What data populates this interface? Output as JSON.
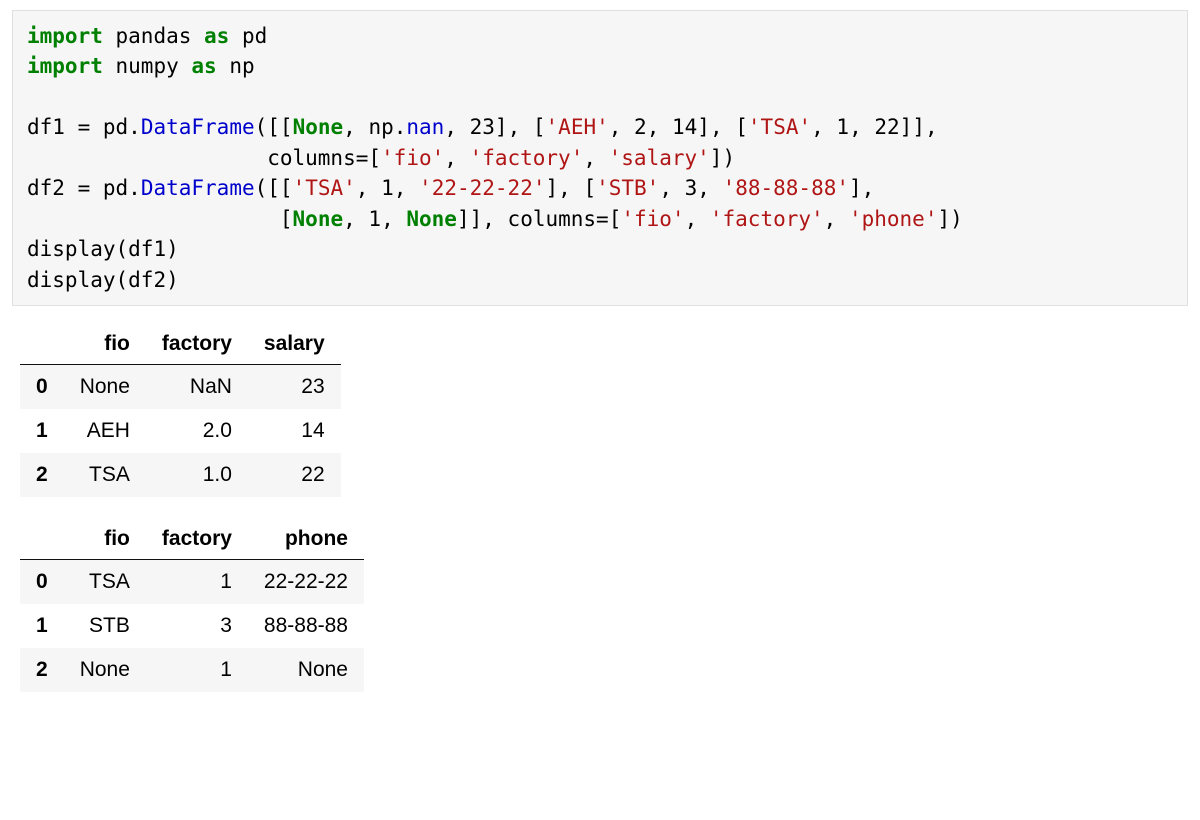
{
  "code": {
    "import_kw": "import",
    "as_kw": "as",
    "pandas": "pandas",
    "pd": "pd",
    "numpy": "numpy",
    "np": "np",
    "df1": "df1",
    "df2": "df2",
    "eq": " = ",
    "pd_pref": "pd.",
    "dataframe": "DataFrame",
    "np_pref": "np.",
    "nan": "nan",
    "none": "None",
    "n23": "23",
    "n2": "2",
    "n14": "14",
    "n1": "1",
    "n22": "22",
    "n3": "3",
    "s_AEH": "'AEH'",
    "s_TSA": "'TSA'",
    "s_STB": "'STB'",
    "s_222222": "'22-22-22'",
    "s_888888": "'88-88-88'",
    "s_fio": "'fio'",
    "s_factory": "'factory'",
    "s_salary": "'salary'",
    "s_phone": "'phone'",
    "columns_kw": "columns=",
    "lp": "(",
    "rp": ")",
    "lb": "[",
    "rb": "]",
    "c": ", ",
    "c2": ",",
    "indent1": "                   ",
    "indent2": "                    ",
    "display": "display",
    "disp1_arg": "(df1)",
    "disp2_arg": "(df2)"
  },
  "tables": {
    "t1": {
      "headers": [
        "",
        "fio",
        "factory",
        "salary"
      ],
      "rows": [
        [
          "0",
          "None",
          "NaN",
          "23"
        ],
        [
          "1",
          "AEH",
          "2.0",
          "14"
        ],
        [
          "2",
          "TSA",
          "1.0",
          "22"
        ]
      ]
    },
    "t2": {
      "headers": [
        "",
        "fio",
        "factory",
        "phone"
      ],
      "rows": [
        [
          "0",
          "TSA",
          "1",
          "22-22-22"
        ],
        [
          "1",
          "STB",
          "3",
          "88-88-88"
        ],
        [
          "2",
          "None",
          "1",
          "None"
        ]
      ]
    }
  },
  "chart_data": [
    {
      "type": "table",
      "title": "df1",
      "columns": [
        "fio",
        "factory",
        "salary"
      ],
      "index": [
        0,
        1,
        2
      ],
      "rows": [
        {
          "fio": null,
          "factory": null,
          "salary": 23
        },
        {
          "fio": "AEH",
          "factory": 2.0,
          "salary": 14
        },
        {
          "fio": "TSA",
          "factory": 1.0,
          "salary": 22
        }
      ]
    },
    {
      "type": "table",
      "title": "df2",
      "columns": [
        "fio",
        "factory",
        "phone"
      ],
      "index": [
        0,
        1,
        2
      ],
      "rows": [
        {
          "fio": "TSA",
          "factory": 1,
          "phone": "22-22-22"
        },
        {
          "fio": "STB",
          "factory": 3,
          "phone": "88-88-88"
        },
        {
          "fio": null,
          "factory": 1,
          "phone": null
        }
      ]
    }
  ]
}
